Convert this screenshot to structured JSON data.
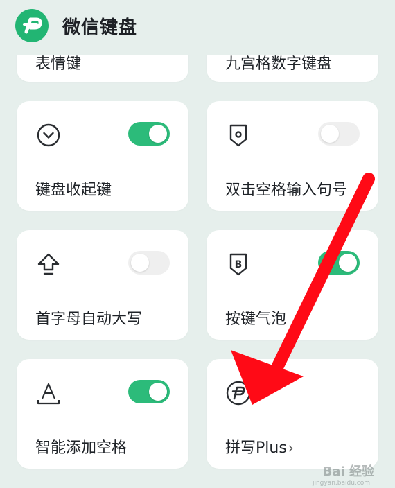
{
  "header": {
    "title": "微信键盘"
  },
  "cards": {
    "emoji_key": {
      "label": "表情键"
    },
    "nine_grid": {
      "label": "九宫格数字键盘"
    },
    "collapse_key": {
      "label": "键盘收起键",
      "enabled": true
    },
    "double_space": {
      "label": "双击空格输入句号",
      "enabled": false
    },
    "auto_capital": {
      "label": "首字母自动大写",
      "enabled": false
    },
    "key_bubble": {
      "label": "按键气泡",
      "enabled": true
    },
    "smart_space": {
      "label": "智能添加空格",
      "enabled": true
    },
    "pinyin_plus": {
      "label": "拼写Plus",
      "chevron": "›"
    }
  },
  "watermark": {
    "text": "Bai 经验",
    "sub": "jingyan.baidu.com"
  },
  "colors": {
    "accent": "#2cbb7a",
    "logo": "#22b573",
    "arrow": "#ff0a16",
    "background": "#e6efec"
  }
}
